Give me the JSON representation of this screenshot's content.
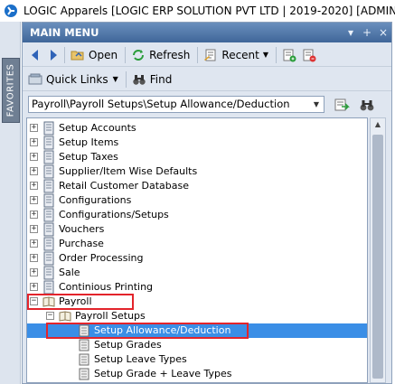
{
  "window": {
    "title": "LOGIC Apparels [LOGIC ERP SOLUTION PVT LTD | 2019-2020] [ADMINISTRATOR"
  },
  "sidebar": {
    "favorites_label": "FAVORITES"
  },
  "panel": {
    "title": "MAIN MENU",
    "header_buttons": [
      "▾",
      "+",
      "×"
    ]
  },
  "toolbar": {
    "open_label": "Open",
    "refresh_label": "Refresh",
    "recent_label": "Recent",
    "quick_links_label": "Quick Links",
    "find_label": "Find"
  },
  "path": {
    "value": "Payroll\\Payroll Setups\\Setup Allowance/Deduction"
  },
  "tree": {
    "items": [
      {
        "label": "Setup Accounts",
        "level": 0,
        "expander": "+"
      },
      {
        "label": "Setup Items",
        "level": 0,
        "expander": "+"
      },
      {
        "label": "Setup Taxes",
        "level": 0,
        "expander": "+"
      },
      {
        "label": "Supplier/Item Wise Defaults",
        "level": 0,
        "expander": "+"
      },
      {
        "label": "Retail Customer Database",
        "level": 0,
        "expander": "+"
      },
      {
        "label": "Configurations",
        "level": 0,
        "expander": "+"
      },
      {
        "label": "Configurations/Setups",
        "level": 0,
        "expander": "+"
      },
      {
        "label": "Vouchers",
        "level": 0,
        "expander": "+"
      },
      {
        "label": "Purchase",
        "level": 0,
        "expander": "+"
      },
      {
        "label": "Order Processing",
        "level": 0,
        "expander": "+"
      },
      {
        "label": "Sale",
        "level": 0,
        "expander": "+"
      },
      {
        "label": "Continious Printing",
        "level": 0,
        "expander": "+"
      },
      {
        "label": "Payroll",
        "level": 0,
        "expander": "−"
      },
      {
        "label": "Payroll Setups",
        "level": 1,
        "expander": "−"
      },
      {
        "label": "Setup Allowance/Deduction",
        "level": 2,
        "expander": ""
      },
      {
        "label": "Setup Grades",
        "level": 2,
        "expander": ""
      },
      {
        "label": "Setup Leave Types",
        "level": 2,
        "expander": ""
      },
      {
        "label": "Setup Grade + Leave Types",
        "level": 2,
        "expander": ""
      }
    ]
  },
  "colors": {
    "header": "#3f6699",
    "selection": "#3a8ee6",
    "highlight_box": "#e3242b"
  }
}
